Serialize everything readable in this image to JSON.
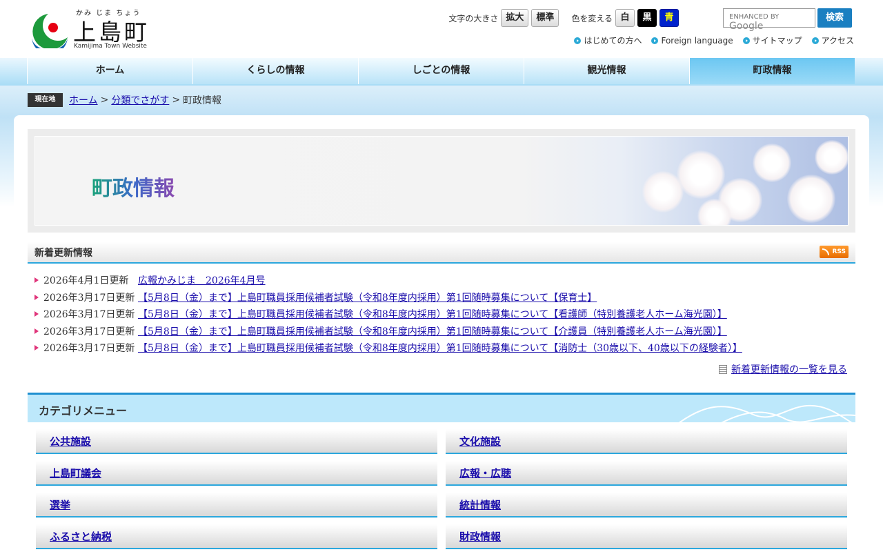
{
  "header": {
    "logo_ruby": "かみ じま ちょう",
    "logo_title": "上島町",
    "logo_sub": "Kamijima Town Website",
    "font_size_label": "文字の大きさ",
    "font_enlarge": "拡大",
    "font_standard": "標準",
    "color_label": "色を変える",
    "color_white": "白",
    "color_black": "黒",
    "color_blue": "青",
    "search_placeholder_brand": "ENHANCED BY",
    "search_placeholder_google": "Google",
    "search_button": "検索",
    "links": [
      "はじめての方へ",
      "Foreign language",
      "サイトマップ",
      "アクセス"
    ]
  },
  "nav": [
    "ホーム",
    "くらしの情報",
    "しごとの情報",
    "観光情報",
    "町政情報"
  ],
  "breadcrumb": {
    "here_label": "現在地",
    "items": [
      "ホーム",
      "分類でさがす",
      "町政情報"
    ],
    "sep": ">"
  },
  "banner": {
    "title": "町政情報"
  },
  "updates": {
    "title": "新着更新情報",
    "rss": "RSS",
    "items": [
      {
        "date": "2026年4月1日更新",
        "title": "広報かみじま　2026年4月号"
      },
      {
        "date": "2026年3月17日更新",
        "title": "【5月8日（金）まで】上島町職員採用候補者試験（令和8年度内採用）第1回随時募集について【保育士】"
      },
      {
        "date": "2026年3月17日更新",
        "title": "【5月8日（金）まで】上島町職員採用候補者試験（令和8年度内採用）第1回随時募集について【看護師（特別養護老人ホーム海光園）】"
      },
      {
        "date": "2026年3月17日更新",
        "title": "【5月8日（金）まで】上島町職員採用候補者試験（令和8年度内採用）第1回随時募集について【介護員（特別養護老人ホーム海光園）】"
      },
      {
        "date": "2026年3月17日更新",
        "title": "【5月8日（金）まで】上島町職員採用候補者試験（令和8年度内採用）第1回随時募集について【消防士（30歳以下、40歳以下の経験者）】"
      }
    ],
    "more": "新着更新情報の一覧を見る"
  },
  "categories": {
    "title": "カテゴリメニュー",
    "items": [
      "公共施設",
      "文化施設",
      "上島町議会",
      "広報・広聴",
      "選挙",
      "統計情報",
      "ふるさと納税",
      "財政情報"
    ]
  },
  "colors": {
    "accent": "#2ba7dd",
    "nav_active": "#6cc7f2",
    "link": "#1a0dab"
  }
}
